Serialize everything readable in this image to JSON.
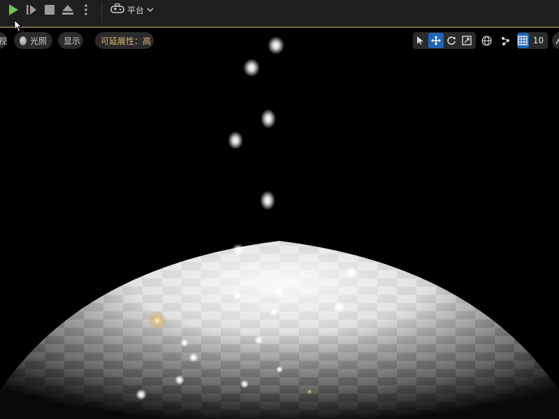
{
  "toolbar": {
    "play_icon": "play-icon",
    "step_icon": "step-forward-icon",
    "stop_icon": "stop-icon",
    "eject_icon": "eject-icon",
    "more_icon": "more-vertical-icon",
    "platform_label": "平台",
    "colors": {
      "bg": "#1e1e1e",
      "play": "#6ec24d",
      "accent_line": "#7a6a44"
    }
  },
  "viewport": {
    "view_mode_label": "视",
    "lighting_label": "光照",
    "show_label": "显示",
    "scalability_label": "可延展性：高",
    "grid_snap_value": "10",
    "tools": [
      "select-icon",
      "translate-icon",
      "rotate-icon",
      "scale-icon",
      "world-space-icon",
      "surface-snap-icon",
      "grid-snap-icon"
    ],
    "active_tool": "translate-icon",
    "colors": {
      "active": "#1f64b8",
      "scalability_text": "#d9b870"
    }
  }
}
